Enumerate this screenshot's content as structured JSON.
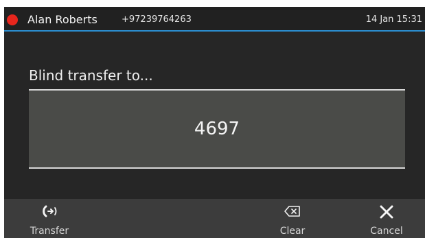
{
  "status_bar": {
    "caller_name": "Alan Roberts",
    "caller_number": "+97239764263",
    "datetime": "14 Jan 15:31",
    "status_color": "#e8261d",
    "accent_color": "#2b8fd3"
  },
  "dialog": {
    "prompt": "Blind transfer to...",
    "entered_number": "4697"
  },
  "softkeys": [
    {
      "label": "Transfer",
      "icon": "transfer-call-icon"
    },
    {
      "label": "Clear",
      "icon": "backspace-icon"
    },
    {
      "label": "Cancel",
      "icon": "close-icon"
    }
  ]
}
